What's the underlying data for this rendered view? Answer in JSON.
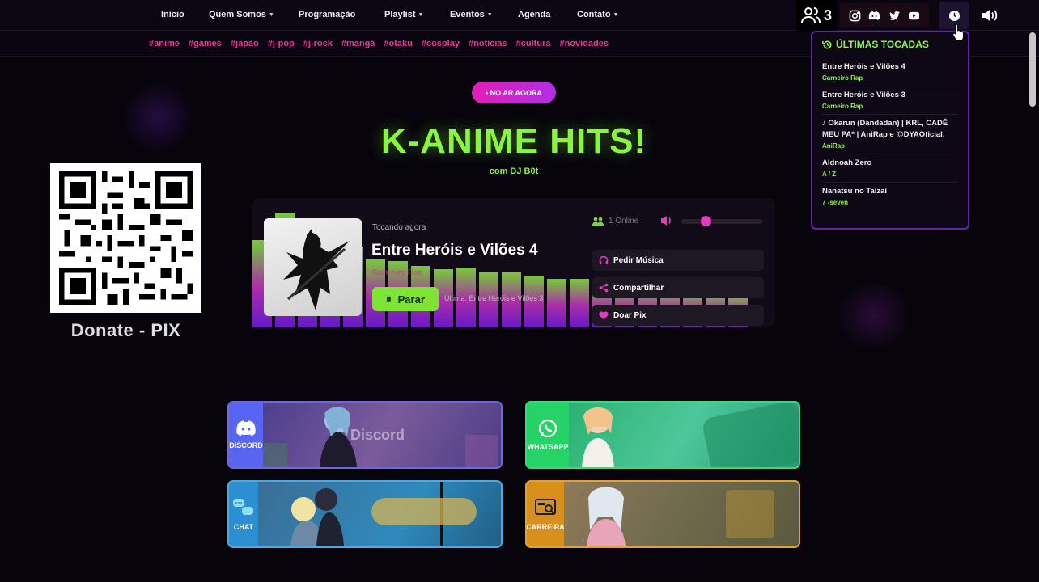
{
  "nav": {
    "items": [
      {
        "label": "Início",
        "caret": false
      },
      {
        "label": "Quem Somos",
        "caret": true
      },
      {
        "label": "Programação",
        "caret": false
      },
      {
        "label": "Playlist",
        "caret": true
      },
      {
        "label": "Eventos",
        "caret": true
      },
      {
        "label": "Agenda",
        "caret": false
      },
      {
        "label": "Contato",
        "caret": true
      }
    ],
    "listeners_count": "3"
  },
  "tags": [
    "#anime",
    "#games",
    "#japão",
    "#j-pop",
    "#j-rock",
    "#mangá",
    "#otaku",
    "#cosplay",
    "#notícias",
    "#cultura",
    "#novidades"
  ],
  "recent": {
    "title": "ÚLTIMAS TOCADAS",
    "items": [
      {
        "title": "Entre Heróis e Vilões 4",
        "artist": "Carneiro Rap"
      },
      {
        "title": "Entre Heróis e Vilões 3",
        "artist": "Carneiro Rap"
      },
      {
        "title": "♪ Okarun (Dandadan) | KRL, CADÊ MEU PA* | AniRap e @DYAOficial.",
        "artist": "AniRap"
      },
      {
        "title": "Aldnoah Zero",
        "artist": "A / Z"
      },
      {
        "title": "Nanatsu no Taizai",
        "artist": "7 -seven"
      }
    ]
  },
  "hero": {
    "onair": "• NO AR AGORA",
    "title": "K-ANIME HITS!",
    "subtitle": "com DJ B0t"
  },
  "donate": {
    "label": "Donate - PIX"
  },
  "player": {
    "now_label": "Tocando agora",
    "title": "Entre Heróis e Vilões 4",
    "artist": "Carneiro Rap",
    "stop_label": "Parar",
    "last": "Última: Entre Heróis e Vilões 3",
    "online": "1 Online",
    "volume": 0.3,
    "buttons": {
      "request": "Pedir Música",
      "share": "Compartilhar",
      "donate": "Doar Pix"
    }
  },
  "banners": {
    "discord": {
      "side": "DISCORD",
      "label": "Discord",
      "color": "#5865f2"
    },
    "whatsapp": {
      "side": "WHATSAPP",
      "color": "#25d366"
    },
    "chat": {
      "side": "CHAT",
      "color": "#2c8fd1"
    },
    "carreira": {
      "side": "CARREIRA",
      "color": "#d98f1c"
    }
  },
  "colors": {
    "accent_green": "#8af53c",
    "accent_pink": "#e02c9c",
    "accent_purple": "#6a1fb3"
  }
}
